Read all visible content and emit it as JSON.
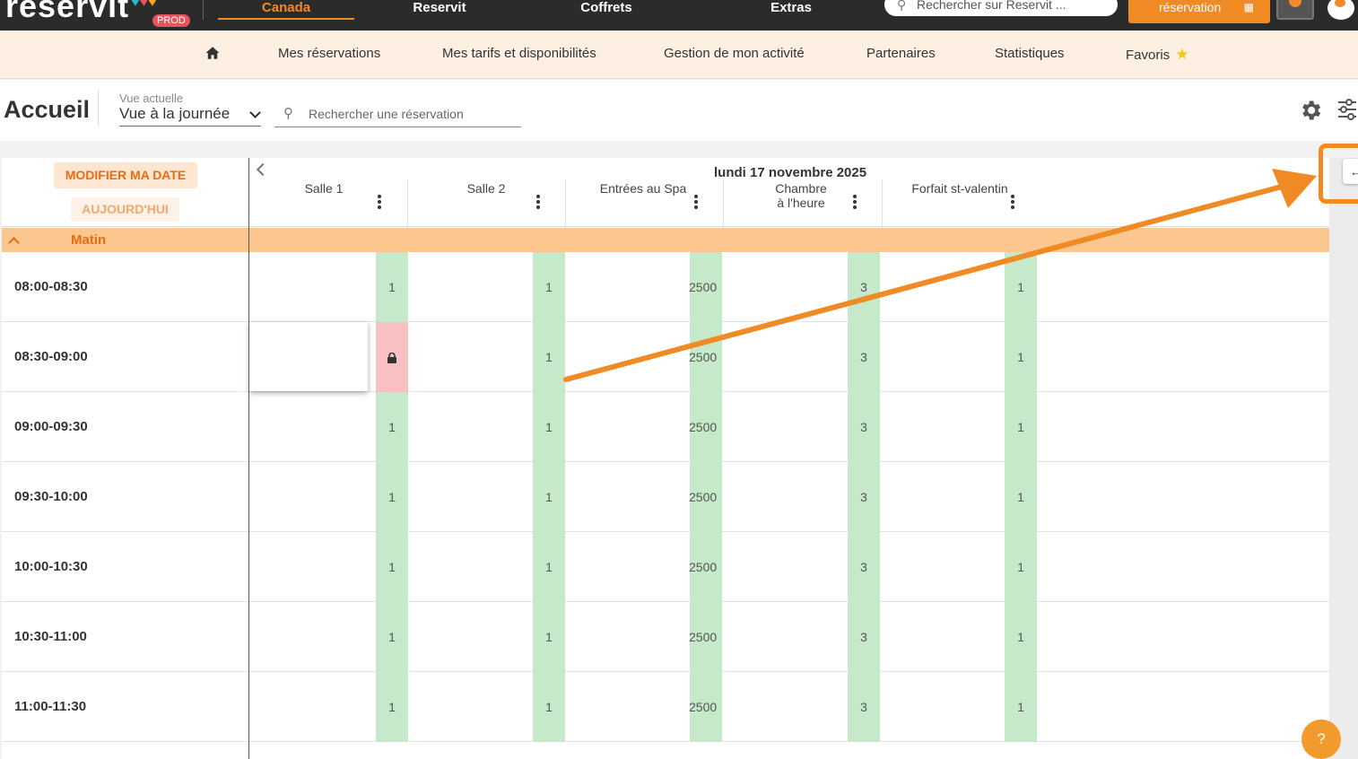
{
  "topbar": {
    "logo_text": "reservit",
    "logo_hearts": "♥♥♥",
    "env_badge": "PROD",
    "nav": [
      {
        "label": "Canada",
        "active": true
      },
      {
        "label": "Reservit",
        "active": false
      },
      {
        "label": "Coffrets",
        "active": false
      },
      {
        "label": "Extras",
        "active": false
      }
    ],
    "search_placeholder": "Rechercher sur Reservit ...",
    "new_reservation_label": "réservation"
  },
  "subnav": {
    "items": [
      {
        "label": "Mes réservations"
      },
      {
        "label": "Mes tarifs et disponibilités"
      },
      {
        "label": "Gestion de mon activité"
      },
      {
        "label": "Partenaires"
      },
      {
        "label": "Statistiques"
      },
      {
        "label": "Favoris"
      }
    ]
  },
  "header": {
    "title": "Accueil",
    "view_label": "Vue actuelle",
    "view_value": "Vue à la journée",
    "search_placeholder": "Rechercher une réservation"
  },
  "grid": {
    "modify_date_label": "MODIFIER MA DATE",
    "today_label": "AUJOURD'HUI",
    "date": "lundi 17 novembre 2025",
    "columns": [
      {
        "name": "Salle 1"
      },
      {
        "name": "Salle 2"
      },
      {
        "name": "Entrées au Spa"
      },
      {
        "name": "Chambre à l'heure"
      },
      {
        "name": "Forfait st-valentin"
      }
    ],
    "section_label": "Matin",
    "rows": [
      {
        "time": "08:00-08:30",
        "values": [
          "1",
          "1",
          "2500",
          "3",
          "1"
        ],
        "locked": [
          false,
          false,
          false,
          false,
          false
        ]
      },
      {
        "time": "08:30-09:00",
        "values": [
          "",
          "1",
          "2500",
          "3",
          "1"
        ],
        "locked": [
          true,
          false,
          false,
          false,
          false
        ]
      },
      {
        "time": "09:00-09:30",
        "values": [
          "1",
          "1",
          "2500",
          "3",
          "1"
        ],
        "locked": [
          false,
          false,
          false,
          false,
          false
        ]
      },
      {
        "time": "09:30-10:00",
        "values": [
          "1",
          "1",
          "2500",
          "3",
          "1"
        ],
        "locked": [
          false,
          false,
          false,
          false,
          false
        ]
      },
      {
        "time": "10:00-10:30",
        "values": [
          "1",
          "1",
          "2500",
          "3",
          "1"
        ],
        "locked": [
          false,
          false,
          false,
          false,
          false
        ]
      },
      {
        "time": "10:30-11:00",
        "values": [
          "1",
          "1",
          "2500",
          "3",
          "1"
        ],
        "locked": [
          false,
          false,
          false,
          false,
          false
        ]
      },
      {
        "time": "11:00-11:30",
        "values": [
          "1",
          "1",
          "2500",
          "3",
          "1"
        ],
        "locked": [
          false,
          false,
          false,
          false,
          false
        ]
      }
    ]
  },
  "help_label": "?",
  "colors": {
    "brand_orange": "#f08a24",
    "available_green": "#c5e9c9",
    "locked_red": "#f7c1c3",
    "section_orange": "#fbc78e"
  }
}
